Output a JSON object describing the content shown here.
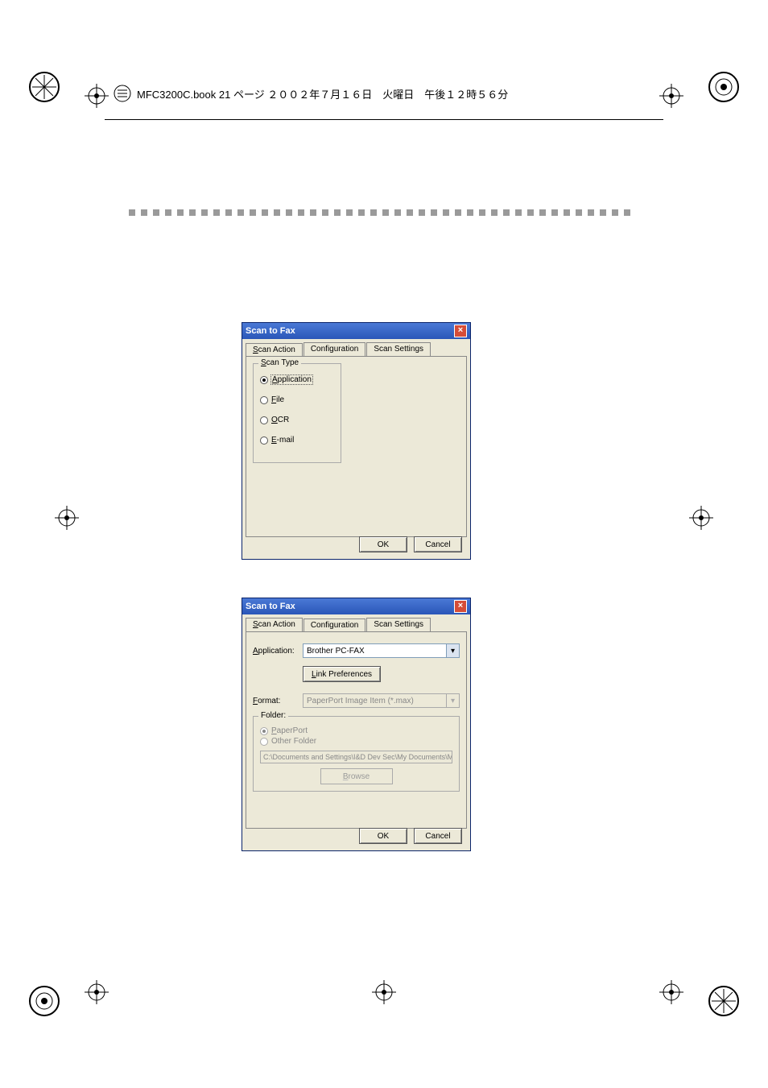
{
  "header": {
    "text": "MFC3200C.book 21 ページ ２００２年７月１６日　火曜日　午後１２時５６分"
  },
  "dialog1": {
    "title": "Scan to Fax",
    "tabs": {
      "t1": "Scan Action",
      "t2": "Configuration",
      "t3": "Scan Settings"
    },
    "group_title": "Scan Type",
    "options": {
      "application": "Application",
      "file": "File",
      "ocr": "OCR",
      "email": "E-mail"
    },
    "ok": "OK",
    "cancel": "Cancel"
  },
  "dialog2": {
    "title": "Scan to Fax",
    "tabs": {
      "t1": "Scan Action",
      "t2": "Configuration",
      "t3": "Scan Settings"
    },
    "app_label": "Application:",
    "app_value": "Brother PC-FAX",
    "link_pref": "Link Preferences",
    "format_label": "Format:",
    "format_value": "PaperPort Image Item (*.max)",
    "folder_title": "Folder:",
    "folder_opts": {
      "paperport": "PaperPort",
      "other": "Other Folder"
    },
    "path": "C:\\Documents and Settings\\I&D Dev Sec\\My Documents\\M",
    "browse": "Browse",
    "ok": "OK",
    "cancel": "Cancel"
  }
}
